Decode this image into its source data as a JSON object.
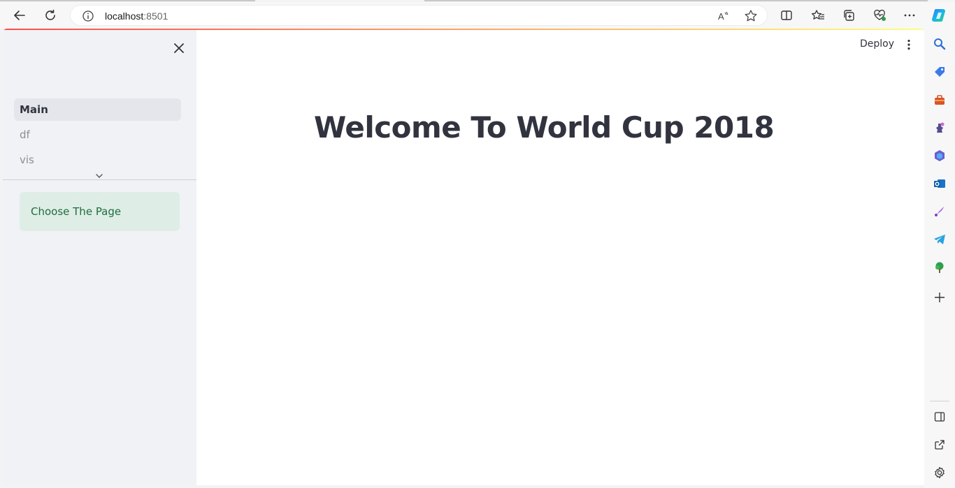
{
  "browser": {
    "url_host": "localhost",
    "url_port": ":8501",
    "toolbar_icons": [
      "back-icon",
      "refresh-icon",
      "read-aloud-icon",
      "favorite-star-icon",
      "split-screen-icon",
      "favorites-icon",
      "collections-icon",
      "browser-essentials-icon",
      "more-icon",
      "copilot-icon"
    ],
    "edge_sidebar_icons": [
      "search-icon",
      "shopping-tag-icon",
      "tools-icon",
      "games-icon",
      "office-icon",
      "outlook-icon",
      "designer-icon",
      "telegram-icon",
      "tree-icon",
      "add-icon",
      "sidebar-toggle-icon",
      "external-link-icon",
      "settings-icon"
    ]
  },
  "app": {
    "header": {
      "deploy_label": "Deploy"
    },
    "sidebar": {
      "nav_items": [
        {
          "label": "Main",
          "active": true
        },
        {
          "label": "df",
          "active": false
        },
        {
          "label": "vis",
          "active": false
        }
      ],
      "info_text": "Choose The Page"
    },
    "main": {
      "title": "Welcome To World Cup 2018"
    }
  },
  "colors": {
    "accent_red": "#ff4b4b",
    "accent_yellow": "#fffd80",
    "sidebar_bg": "#f0f2f6",
    "info_bg": "#dfede7",
    "info_text": "#1e6e3a",
    "text": "#31333f"
  }
}
